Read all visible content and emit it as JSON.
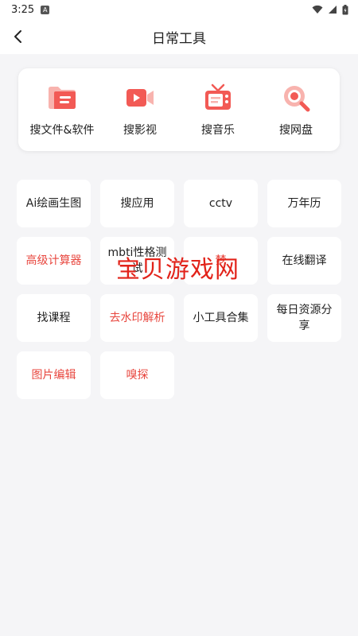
{
  "status": {
    "time": "3:25",
    "notification_badge": "A"
  },
  "header": {
    "title": "日常工具"
  },
  "search_card": {
    "items": [
      {
        "label": "搜文件&软件",
        "icon": "folder-icon"
      },
      {
        "label": "搜影视",
        "icon": "video-camera-icon"
      },
      {
        "label": "搜音乐",
        "icon": "tv-icon"
      },
      {
        "label": "搜网盘",
        "icon": "magnifier-icon"
      }
    ]
  },
  "tools": [
    {
      "label": "Ai绘画生图",
      "accent": false
    },
    {
      "label": "搜应用",
      "accent": false
    },
    {
      "label": "cctv",
      "accent": false
    },
    {
      "label": "万年历",
      "accent": false
    },
    {
      "label": "高级计算器",
      "accent": true
    },
    {
      "label": "mbti性格测试",
      "accent": false
    },
    {
      "label": "梦",
      "accent": true
    },
    {
      "label": "在线翻译",
      "accent": false
    },
    {
      "label": "找课程",
      "accent": false
    },
    {
      "label": "去水印解析",
      "accent": true
    },
    {
      "label": "小工具合集",
      "accent": false
    },
    {
      "label": "每日资源分享",
      "accent": false
    },
    {
      "label": "图片编辑",
      "accent": true
    },
    {
      "label": "嗅探",
      "accent": true
    }
  ],
  "watermark": "宝贝游戏网",
  "colors": {
    "accent": "#e8473f",
    "icon_red": "#f25a55",
    "background": "#f5f5f7"
  }
}
